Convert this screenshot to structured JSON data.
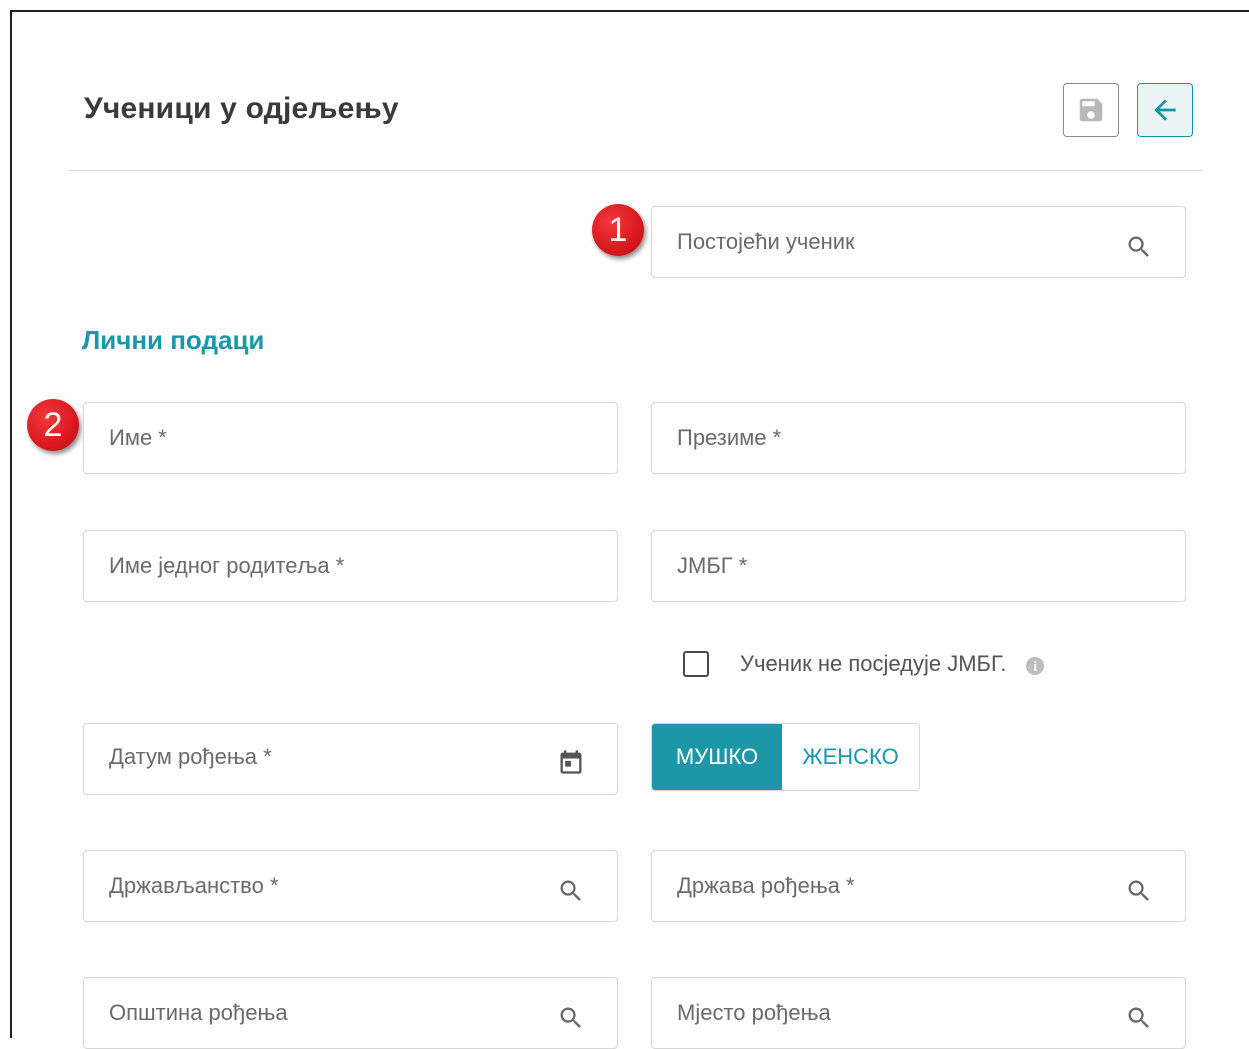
{
  "header": {
    "title": "Ученици у одјељењу",
    "save_icon": "save-icon",
    "back_icon": "arrow-left-icon"
  },
  "search_existing": {
    "placeholder": "Постојећи ученик",
    "icon": "search-icon"
  },
  "annotations": {
    "badge1": "1",
    "badge2": "2"
  },
  "personal_section": {
    "title": "Лични подаци"
  },
  "fields": {
    "first_name": "Име *",
    "last_name": "Презиме *",
    "parent_name": "Име једног родитеља *",
    "jmbg": "ЈМБГ *",
    "birth_date": "Датум рођења *",
    "citizenship": "Држављанство *",
    "birth_country": "Држава рођења *",
    "birth_municipality": "Општина рођења",
    "birth_place": "Мјесто рођења"
  },
  "no_jmbg": {
    "label": "Ученик не посједује ЈМБГ.",
    "checked": false
  },
  "gender": {
    "male": "МУШКО",
    "female": "ЖЕНСКО",
    "selected": "male"
  },
  "colors": {
    "accent": "#1c97a7",
    "badge": "#d9181e"
  }
}
